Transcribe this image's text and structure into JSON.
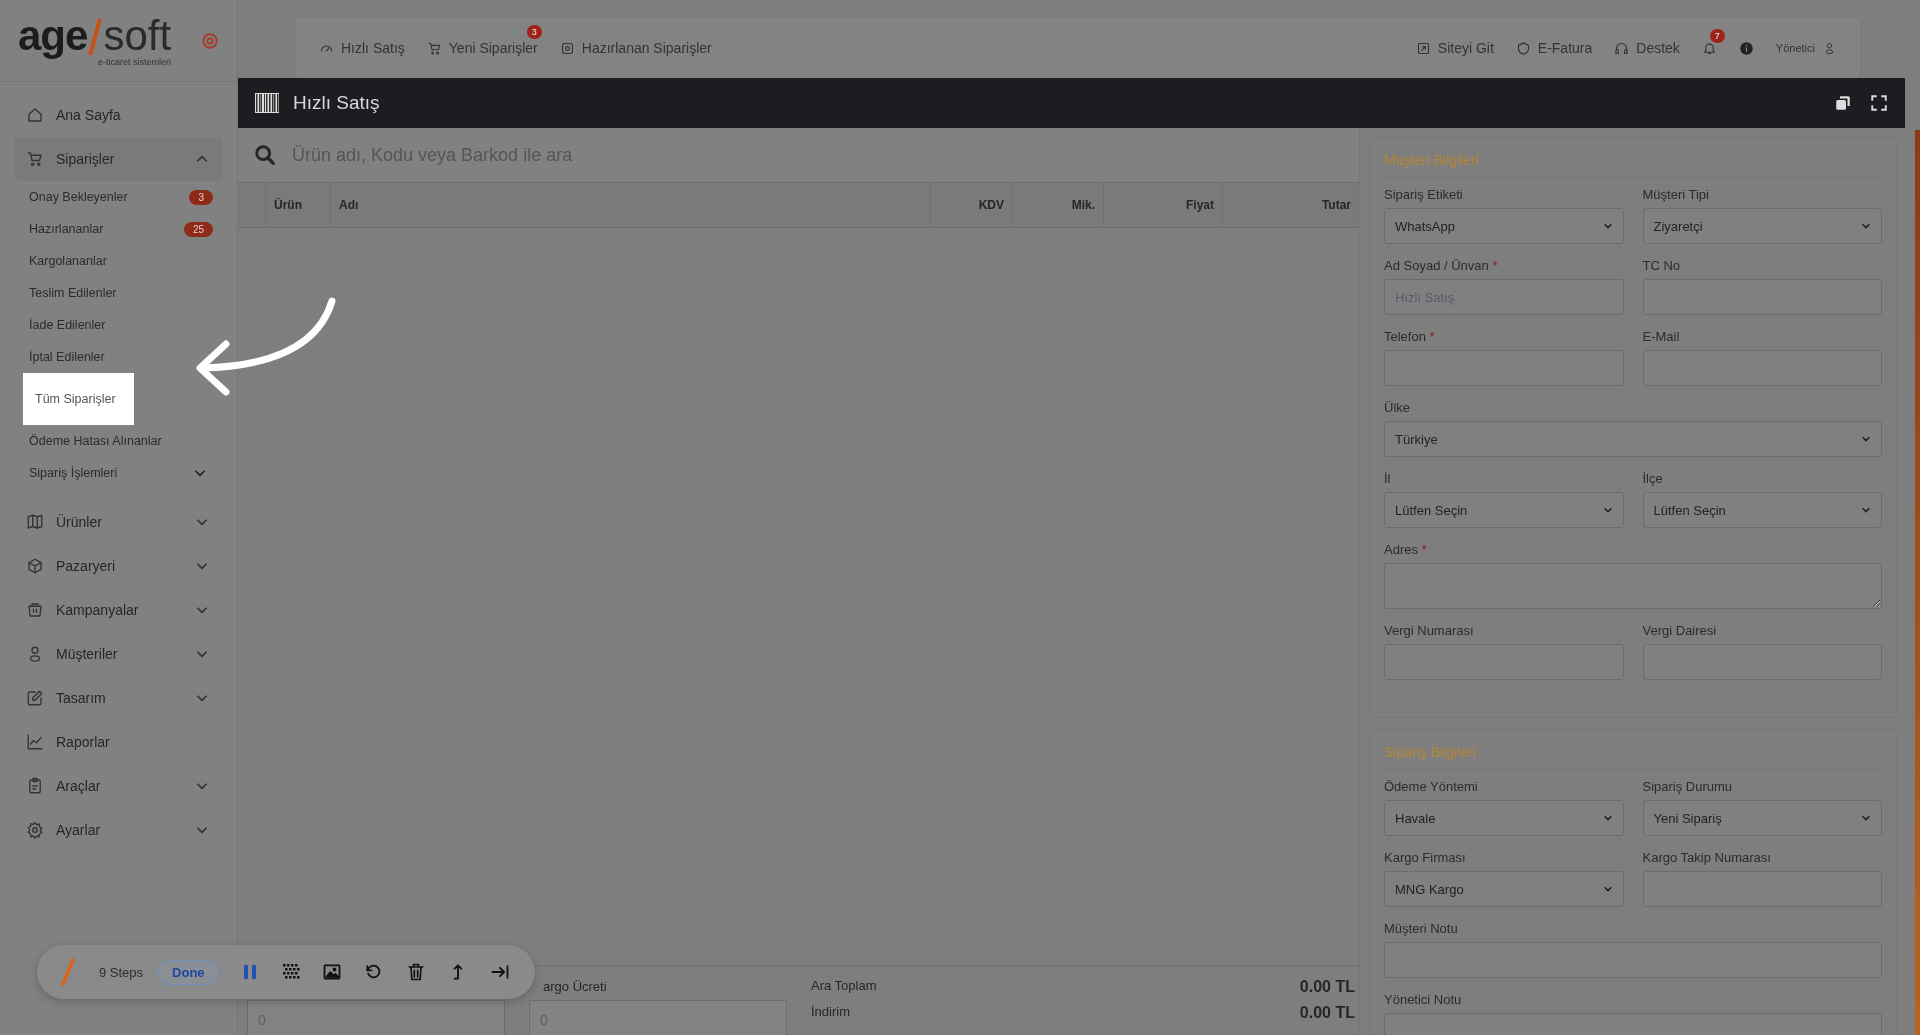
{
  "logo": {
    "wordmark_left": "age",
    "wordmark_right": "soft",
    "tagline": "e-ticaret sistemleri"
  },
  "sidebar": {
    "items": [
      {
        "label": "Ana Sayfa",
        "kind": "link"
      },
      {
        "label": "Siparişler",
        "kind": "group",
        "expanded": true,
        "children": [
          {
            "label": "Onay Bekleyenler",
            "badge": "3",
            "kind": "link",
            "spotlight": false
          },
          {
            "label": "Hazırlananlar",
            "badge": "25",
            "kind": "link",
            "spotlight": false
          },
          {
            "label": "Kargolananlar",
            "kind": "link",
            "spotlight": false
          },
          {
            "label": "Teslim Edilenler",
            "kind": "link",
            "spotlight": false
          },
          {
            "label": "İade Edilenler",
            "kind": "link",
            "spotlight": false
          },
          {
            "label": "İptal Edilenler",
            "kind": "link",
            "spotlight": false
          },
          {
            "label": "Tüm Siparişler",
            "kind": "link",
            "spotlight": true
          },
          {
            "label": "Ödeme Hatası Alınanlar",
            "kind": "link",
            "spotlight": false
          },
          {
            "label": "Sipariş İşlemleri",
            "kind": "group",
            "expanded": false,
            "spotlight": false
          }
        ]
      },
      {
        "label": "Ürünler",
        "kind": "group",
        "expanded": false
      },
      {
        "label": "Pazaryeri",
        "kind": "group",
        "expanded": false
      },
      {
        "label": "Kampanyalar",
        "kind": "group",
        "expanded": false
      },
      {
        "label": "Müşteriler",
        "kind": "group",
        "expanded": false
      },
      {
        "label": "Tasarım",
        "kind": "group",
        "expanded": false
      },
      {
        "label": "Raporlar",
        "kind": "link"
      },
      {
        "label": "Araçlar",
        "kind": "group",
        "expanded": false
      },
      {
        "label": "Ayarlar",
        "kind": "group",
        "expanded": false
      }
    ]
  },
  "topbar": {
    "nav_left": [
      {
        "label": "Hızlı Satış"
      },
      {
        "label": "Yeni Siparişler",
        "badge": "3"
      },
      {
        "label": "Hazırlanan Siparişler"
      }
    ],
    "nav_right": [
      {
        "label": "Siteyi Git"
      },
      {
        "label": "E-Fatura"
      },
      {
        "label": "Destek"
      }
    ],
    "notifications_badge": "7",
    "user": "Yönetici"
  },
  "panel": {
    "title": "Hızlı Satış",
    "search": {
      "placeholder": "Ürün adı, Kodu veya Barkod ile ara"
    },
    "table": {
      "columns": [
        "Ürün",
        "Adı",
        "KDV",
        "Mik.",
        "Fiyat",
        "Tutar"
      ]
    },
    "footer": {
      "fields": [
        {
          "placeholder": "0"
        },
        {
          "label": "argo Ücreti",
          "placeholder": "0"
        }
      ],
      "totals": [
        {
          "label": "Ara Toplam",
          "value": "0.00 TL"
        },
        {
          "label": "İndirim",
          "value": "0.00 TL"
        }
      ]
    }
  },
  "cards": [
    {
      "title": "Müşteri Bilgileri",
      "rows": [
        [
          {
            "label": "Sipariş Etiketi",
            "kind": "select",
            "value": "WhatsApp"
          },
          {
            "label": "Müşteri Tipi",
            "kind": "select",
            "value": "Ziyaretçi"
          }
        ],
        [
          {
            "label": "Ad Soyad / Ünvan",
            "required_mark": "*",
            "kind": "input",
            "placeholder": "Hızlı Satış"
          },
          {
            "label": "TC No",
            "kind": "input"
          }
        ],
        [
          {
            "label": "Telefon",
            "required_mark": "*",
            "kind": "input"
          },
          {
            "label": "E-Mail",
            "kind": "input"
          }
        ],
        [
          {
            "label": "Ülke",
            "kind": "select",
            "value": "Türkiye"
          }
        ],
        [
          {
            "label": "İl",
            "kind": "select",
            "value": "Lütfen Seçin"
          },
          {
            "label": "İlçe",
            "kind": "select",
            "value": "Lütfen Seçin"
          }
        ],
        [
          {
            "label": "Adres",
            "required_mark": "*",
            "kind": "textarea"
          }
        ],
        [
          {
            "label": "Vergi Numarası",
            "kind": "input"
          },
          {
            "label": "Vergi Dairesi",
            "kind": "input"
          }
        ]
      ]
    },
    {
      "title": "Sipariş Bilgileri",
      "rows": [
        [
          {
            "label": "Ödeme Yöntemi",
            "kind": "select",
            "value": "Havale"
          },
          {
            "label": "Sipariş Durumu",
            "kind": "select",
            "value": "Yeni Sipariş"
          }
        ],
        [
          {
            "label": "Kargo Firması",
            "kind": "select",
            "value": "MNG Kargo"
          },
          {
            "label": "Kargo Takip Numarası",
            "kind": "input"
          }
        ],
        [
          {
            "label": "Müşteri Notu",
            "kind": "input"
          }
        ],
        [
          {
            "label": "Yönetici Notu",
            "kind": "input"
          }
        ]
      ]
    }
  ],
  "recorder": {
    "steps": "9 Steps",
    "done": "Done"
  }
}
